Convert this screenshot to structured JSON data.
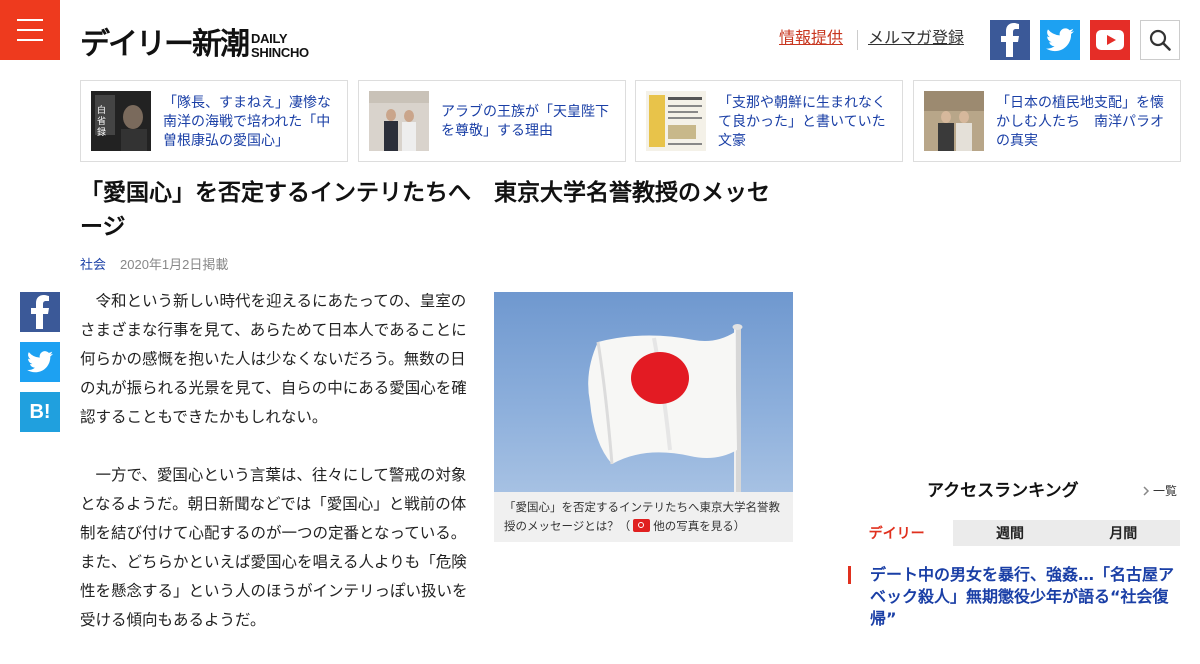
{
  "header": {
    "logo_jp": "デイリー新潮",
    "logo_en_1": "DAILY",
    "logo_en_2": "SHINCHO",
    "link_info": "情報提供",
    "link_mailmag": "メルマガ登録"
  },
  "related": [
    {
      "text": "「隊長、すまねえ」凄惨な南洋の海戦で培われた「中曽根康弘の愛国心」"
    },
    {
      "text": "アラブの王族が「天皇陛下を尊敬」する理由"
    },
    {
      "text": "「支那や朝鮮に生まれなくて良かった」と書いていた文豪"
    },
    {
      "text": "「日本の植民地支配」を懐かしむ人たち　南洋パラオの真実"
    }
  ],
  "article": {
    "title": "「愛国心」を否定するインテリたちへ　東京大学名誉教授のメッセージ",
    "category": "社会",
    "date": "2020年1月2日掲載",
    "paragraphs": [
      "令和という新しい時代を迎えるにあたっての、皇室のさまざまな行事を見て、あらためて日本人であることに何らかの感慨を抱いた人は少なくないだろう。無数の日の丸が振られる光景を見て、自らの中にある愛国心を確認することもできたかもしれない。",
      "一方で、愛国心という言葉は、往々にして警戒の対象となるようだ。朝日新聞などでは「愛国心」と戦前の体制を結び付けて心配するのが一つの定番となっている。また、どちらかといえば愛国心を唱える人よりも「危険性を懸念する」という人のほうがインテリっぽい扱いを受ける傾向もあるようだ。"
    ],
    "caption": "「愛国心」を否定するインテリたちへ東京大学名誉教授のメッセージとは？（",
    "caption_link": "他の写真を見る",
    "caption_end": "）"
  },
  "ranking": {
    "title": "アクセスランキング",
    "list_link": "一覧",
    "tabs": [
      "デイリー",
      "週間",
      "月間"
    ],
    "active_tab": 0,
    "items": [
      {
        "title": "デート中の男女を暴行、強姦…「名古屋アベック殺人」無期懲役少年が語る“社会復帰”"
      }
    ]
  },
  "colors": {
    "brand_red": "#ee3a1e",
    "facebook": "#3b5998",
    "twitter": "#1da1f2",
    "youtube": "#e52d27",
    "hatena": "#20a0de",
    "link_blue": "#1a3fa6"
  },
  "icons": {
    "menu": "hamburger-icon",
    "facebook": "facebook-icon",
    "twitter": "twitter-icon",
    "youtube": "youtube-icon",
    "search": "search-icon",
    "hatena": "hatena-bookmark-icon",
    "camera": "camera-icon",
    "chevron": "chevron-right-icon"
  }
}
